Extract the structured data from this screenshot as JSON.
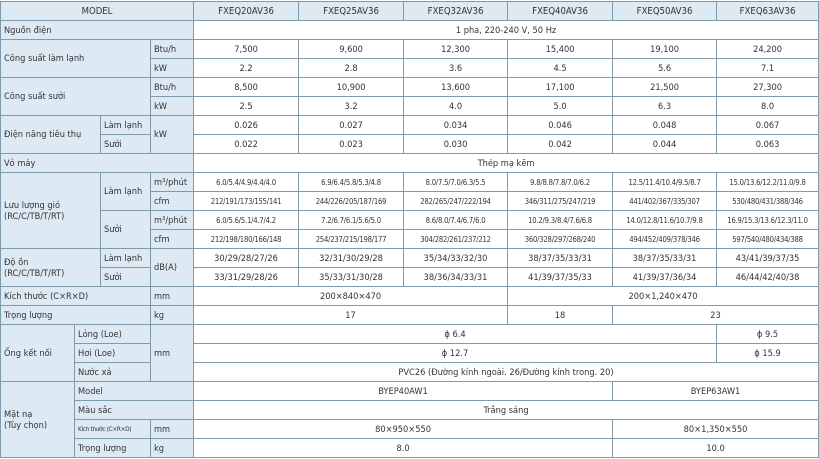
{
  "header": {
    "model": "MODEL",
    "models": [
      "FXEQ20AV36",
      "FXEQ25AV36",
      "FXEQ32AV36",
      "FXEQ40AV36",
      "FXEQ50AV36",
      "FXEQ63AV36"
    ]
  },
  "power_supply": {
    "label": "Nguồn điện",
    "value": "1 pha, 220-240 V, 50 Hz"
  },
  "cooling_capacity": {
    "label": "Công suất làm lạnh",
    "btuh_unit": "Btu/h",
    "btuh": [
      "7,500",
      "9,600",
      "12,300",
      "15,400",
      "19,100",
      "24,200"
    ],
    "kw_unit": "kW",
    "kw": [
      "2.2",
      "2.8",
      "3.6",
      "4.5",
      "5.6",
      "7.1"
    ]
  },
  "heating_capacity": {
    "label": "Công suất sưởi",
    "btuh_unit": "Btu/h",
    "btuh": [
      "8,500",
      "10,900",
      "13,600",
      "17,100",
      "21,500",
      "27,300"
    ],
    "kw_unit": "kW",
    "kw": [
      "2.5",
      "3.2",
      "4.0",
      "5.0",
      "6.3",
      "8.0"
    ]
  },
  "power_consumption": {
    "label": "Điện năng tiêu thụ",
    "unit": "kW",
    "cool_label": "Làm lạnh",
    "cool": [
      "0.026",
      "0.027",
      "0.034",
      "0.046",
      "0.048",
      "0.067"
    ],
    "heat_label": "Sưởi",
    "heat": [
      "0.022",
      "0.023",
      "0.030",
      "0.042",
      "0.044",
      "0.063"
    ]
  },
  "casing": {
    "label": "Vỏ máy",
    "value": "Thép mạ kẽm"
  },
  "airflow": {
    "label_line1": "Lưu lượng gió",
    "label_line2": "(RC/C/TB/T/RT)",
    "cool_label": "Làm lạnh",
    "heat_label": "Sưởi",
    "m3_unit": "m³/phút",
    "cfm_unit": "cfm",
    "cool_m3": [
      "6.0/5.4/4.9/4.4/4.0",
      "6.9/6.4/5.8/5.3/4.8",
      "8.0/7.5/7.0/6.3/5.5",
      "9.8/8.8/7.8/7.0/6.2",
      "12.5/11.4/10.4/9.5/8.7",
      "15.0/13.6/12.2/11.0/9.8"
    ],
    "cool_cfm": [
      "212/191/173/155/141",
      "244/226/205/187/169",
      "282/265/247/222/194",
      "346/311/275/247/219",
      "441/402/367/335/307",
      "530/480/431/388/346"
    ],
    "heat_m3": [
      "6.0/5.6/5.1/4.7/4.2",
      "7.2/6.7/6.1/5.6/5.0",
      "8.6/8.0/7.4/6.7/6.0",
      "10.2/9.3/8.4/7.6/6.8",
      "14.0/12.8/11.6/10.7/9.8",
      "16.9/15.3/13.6/12.3/11.0"
    ],
    "heat_cfm": [
      "212/198/180/166/148",
      "254/237/215/198/177",
      "304/282/261/237/212",
      "360/328/297/268/240",
      "494/452/409/378/346",
      "597/540/480/434/388"
    ]
  },
  "noise": {
    "label_line1": "Độ ồn",
    "label_line2": "(RC/C/TB/T/RT)",
    "unit": "dB(A)",
    "cool_label": "Làm lạnh",
    "heat_label": "Sưởi",
    "cool": [
      "30/29/28/27/26",
      "32/31/30/29/28",
      "35/34/33/32/30",
      "38/37/35/33/31",
      "38/37/35/33/31",
      "43/41/39/37/35"
    ],
    "heat": [
      "33/31/29/28/26",
      "35/33/31/30/28",
      "38/36/34/33/31",
      "41/39/37/35/33",
      "41/39/37/36/34",
      "46/44/42/40/38"
    ]
  },
  "dimensions": {
    "label": "Kích thước (C×R×D)",
    "unit": "mm",
    "small": "200×840×470",
    "large": "200×1,240×470"
  },
  "weight": {
    "label": "Trọng lượng",
    "unit": "kg",
    "w1": "17",
    "w2": "18",
    "w3": "23"
  },
  "piping": {
    "label": "Ống kết nối",
    "unit": "mm",
    "liquid_label": "Lỏng (Loe)",
    "liquid_small": "ϕ 6.4",
    "liquid_large": "ϕ 9.5",
    "gas_label": "Hơi (Loe)",
    "gas_small": "ϕ 12.7",
    "gas_large": "ϕ 15.9",
    "drain_label": "Nước xả",
    "drain": "PVC26 (Đường kính ngoài. 26/Đường kính trong. 20)"
  },
  "panel": {
    "label_line1": "Mặt nạ",
    "label_line2": "(Tùy chọn)",
    "model_label": "Model",
    "model_small": "BYEP40AW1",
    "model_large": "BYEP63AW1",
    "color_label": "Màu sắc",
    "color": "Trắng sáng",
    "dim_label": "Kích thước (C×R×D)",
    "dim_unit": "mm",
    "dim_small": "80×950×550",
    "dim_large": "80×1,350×550",
    "weight_label": "Trọng lượng",
    "weight_unit": "kg",
    "weight_small": "8.0",
    "weight_large": "10.0"
  }
}
